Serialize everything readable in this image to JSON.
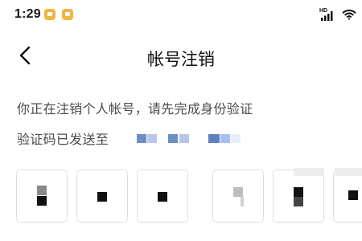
{
  "status_bar": {
    "time": "1:29",
    "hd_label": "HD",
    "icons": [
      "app-notification-icon",
      "app-notification-icon",
      "signal-icon",
      "wifi-icon"
    ],
    "badge_color": "#f2b544"
  },
  "header": {
    "title": "帐号注销",
    "back_icon": "chevron-left-icon"
  },
  "content": {
    "line1": "你正在注销个人帐号，请先完成身份验证",
    "line2": "验证码已发送至",
    "masked_phone": ""
  },
  "verification": {
    "boxes": [
      {
        "state": "filled"
      },
      {
        "state": "filled"
      },
      {
        "state": "filled"
      },
      {
        "state": "filled"
      },
      {
        "state": "filled"
      },
      {
        "state": "filled"
      }
    ]
  },
  "colors": {
    "background": "#ffffff",
    "text": "#4a4a4a",
    "title": "#111111",
    "border": "#dedede",
    "masked_blue": "#6f8fc2",
    "masked_light": "#d8e4f6"
  }
}
